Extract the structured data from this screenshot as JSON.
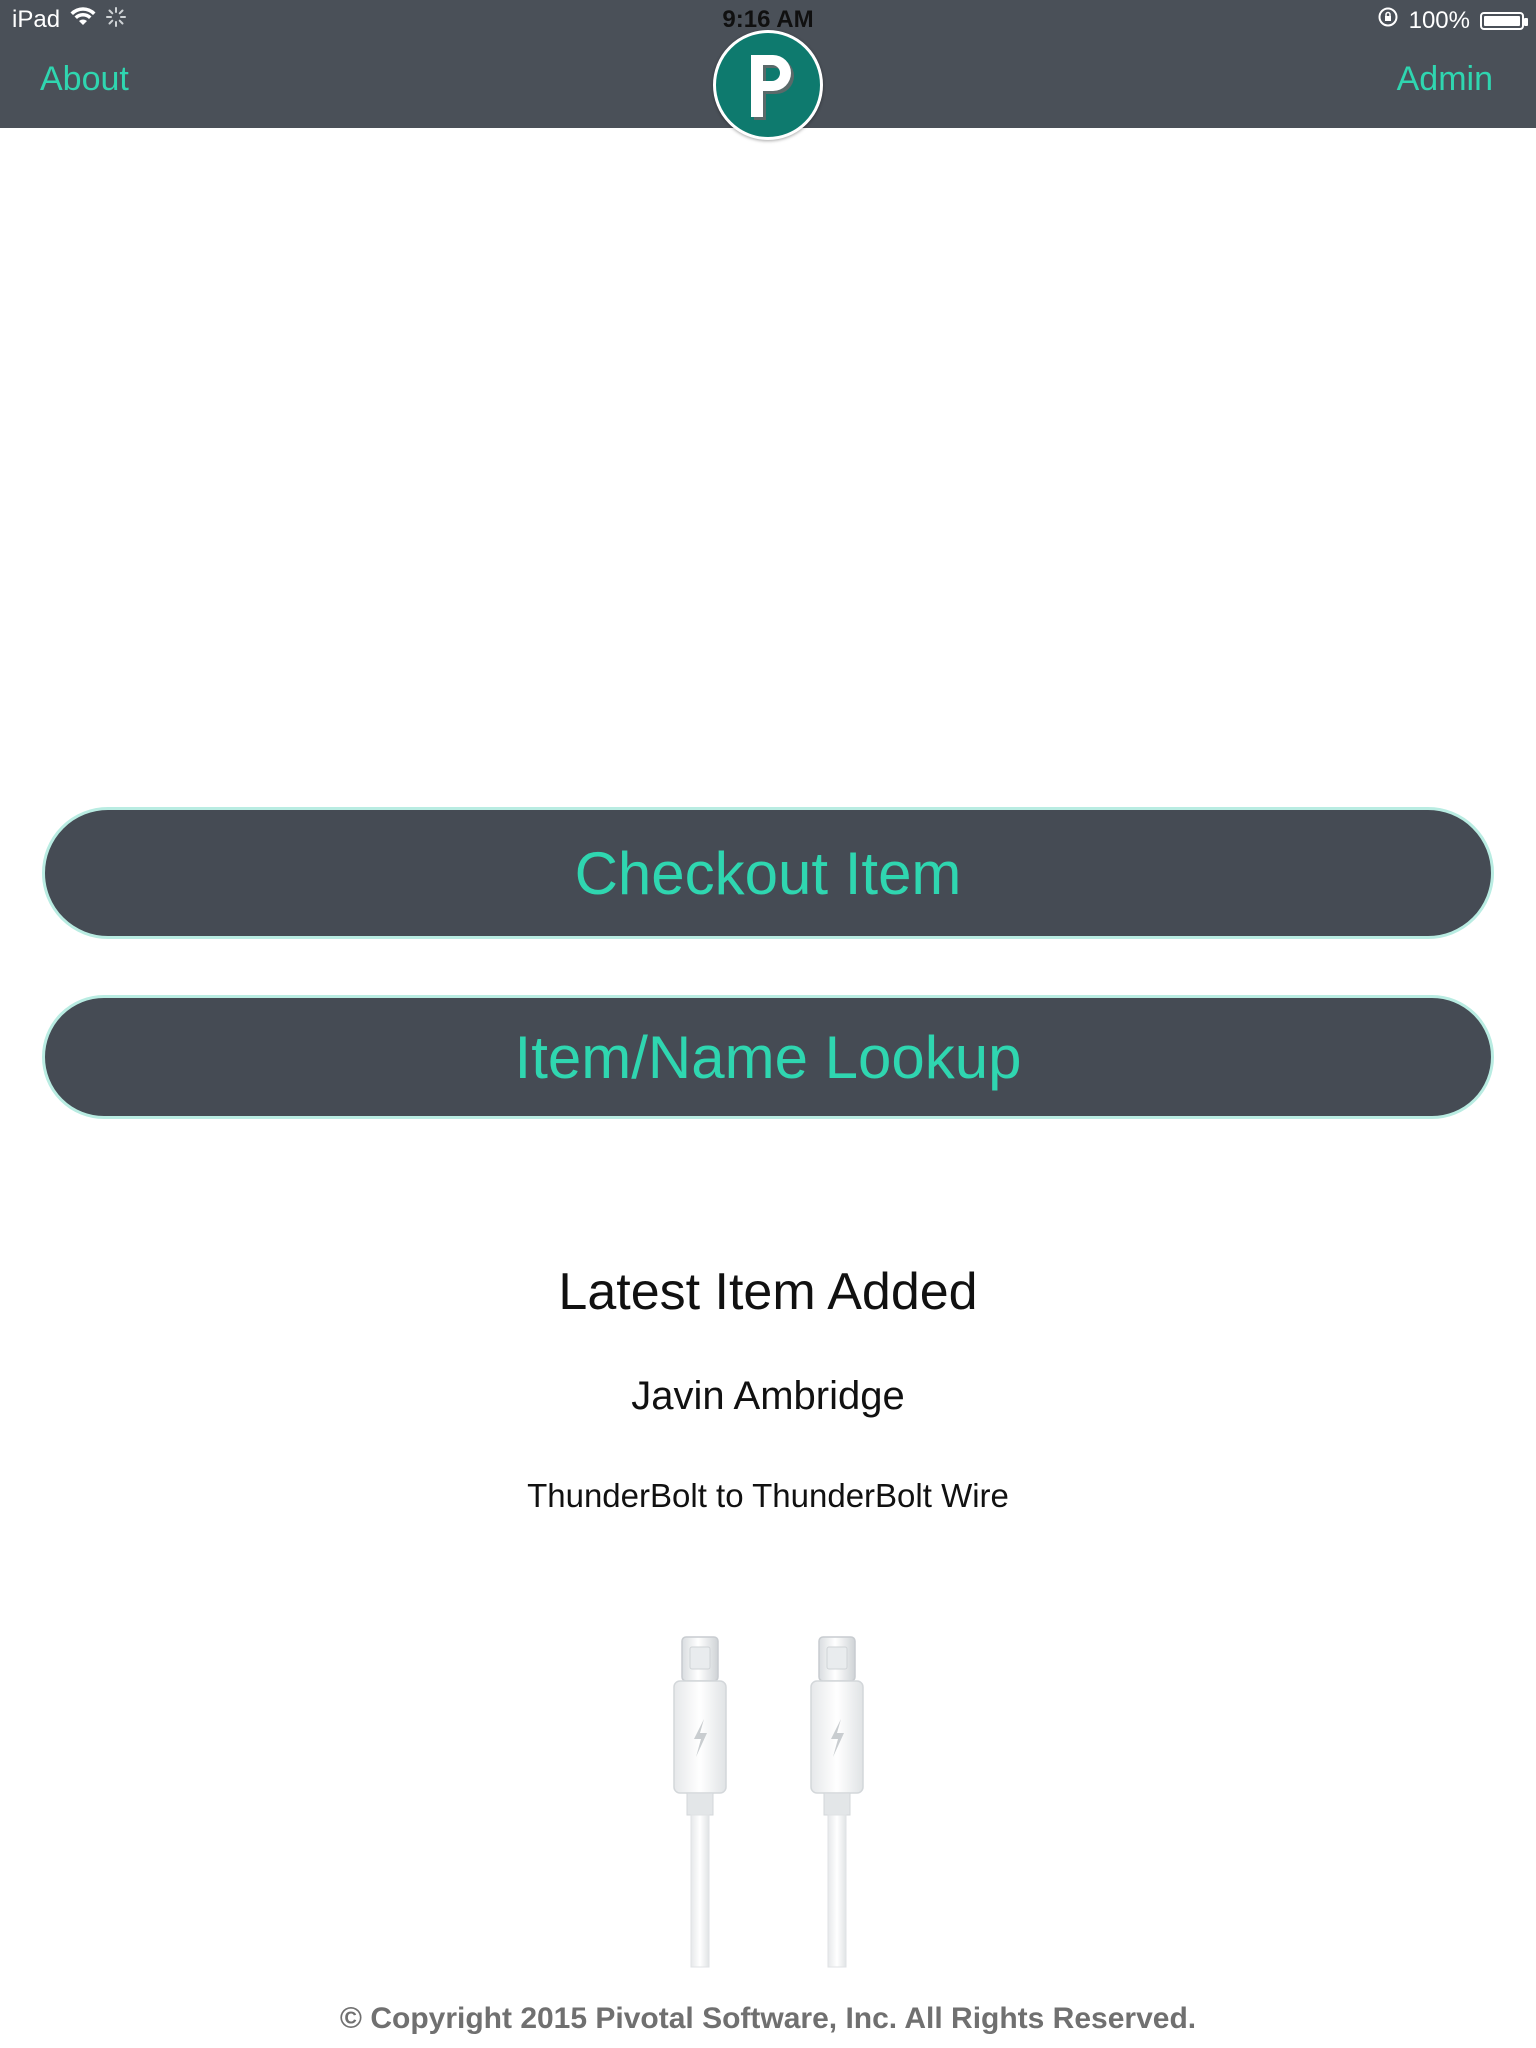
{
  "status_bar": {
    "device": "iPad",
    "time": "9:16 AM",
    "battery": "100%"
  },
  "nav": {
    "left_link": "About",
    "right_link": "Admin",
    "logo_letter": "P"
  },
  "actions": {
    "checkout_label": "Checkout Item",
    "lookup_label": "Item/Name Lookup"
  },
  "latest": {
    "heading": "Latest Item Added",
    "person": "Javin Ambridge",
    "item": "ThunderBolt to ThunderBolt Wire"
  },
  "footer": {
    "copyright": "© Copyright 2015 Pivotal Software, Inc. All Rights Reserved."
  },
  "colors": {
    "accent": "#2fd6b0",
    "bar_bg": "#4a5058",
    "button_bg": "#454b54",
    "logo_bg": "#0e7a6e"
  },
  "icons": [
    "wifi-icon",
    "activity-spinner-icon",
    "orientation-lock-icon",
    "battery-icon",
    "logo-p-icon",
    "thunderbolt-cable-image"
  ]
}
